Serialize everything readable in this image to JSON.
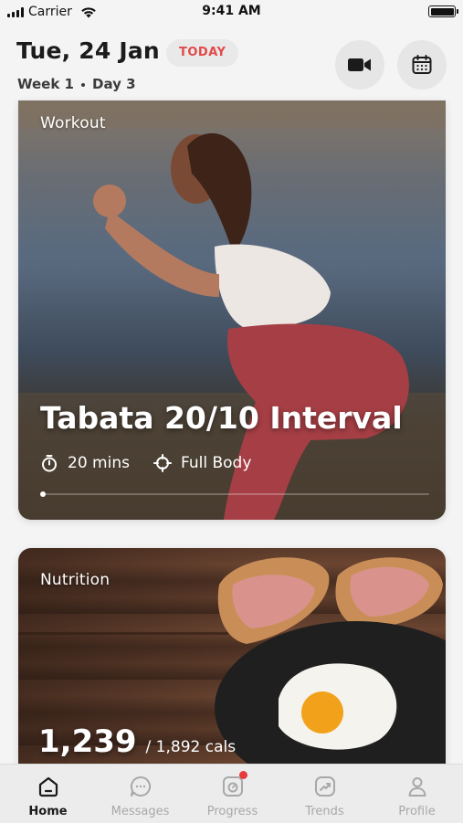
{
  "status_bar": {
    "carrier": "Carrier",
    "time": "9:41 AM"
  },
  "header": {
    "date": "Tue, 24 Jan",
    "today_badge": "TODAY",
    "week": "Week 1",
    "day": "Day 3",
    "buttons": [
      "video-icon",
      "calendar-icon"
    ]
  },
  "workout_card": {
    "label": "Workout",
    "title": "Tabata 20/10 Interval",
    "duration": "20 mins",
    "focus": "Full Body"
  },
  "nutrition_card": {
    "label": "Nutrition",
    "consumed": "1,239",
    "target": "/ 1,892 cals"
  },
  "tab_bar": {
    "items": [
      {
        "label": "Home",
        "icon": "home-icon",
        "active": true
      },
      {
        "label": "Messages",
        "icon": "messages-icon",
        "active": false
      },
      {
        "label": "Progress",
        "icon": "progress-icon",
        "active": false
      },
      {
        "label": "Trends",
        "icon": "trends-icon",
        "active": false
      },
      {
        "label": "Profile",
        "icon": "profile-icon",
        "active": false
      }
    ]
  },
  "colors": {
    "accent": "#e24a4a",
    "badge": "#e63b3b",
    "inactive_tab": "#a8a8a8"
  }
}
